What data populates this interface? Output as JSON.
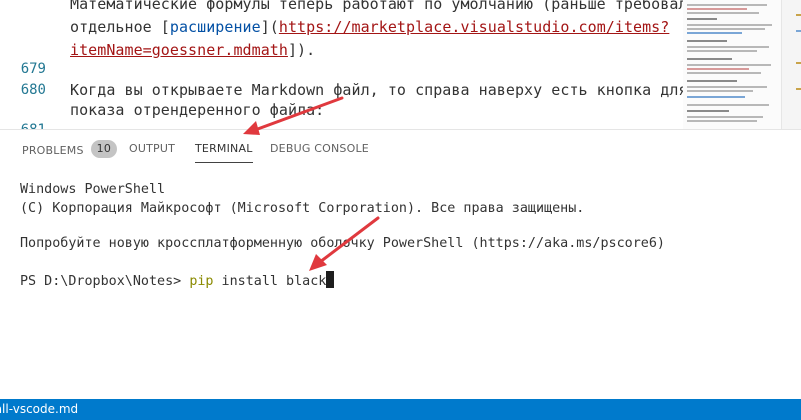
{
  "editor": {
    "lines": [
      {
        "number": "",
        "parts": [
          {
            "text": "Математические формулы теперь работают по умолчанию (раньше требовалось",
            "style": "plain"
          }
        ]
      },
      {
        "number": "",
        "parts": [
          {
            "text": "отдельное [",
            "style": "plain"
          },
          {
            "text": "расширение",
            "style": "blue"
          },
          {
            "text": "](",
            "style": "plain"
          },
          {
            "text": "https://marketplace.visualstudio.com/items?",
            "style": "link"
          }
        ]
      },
      {
        "number": "",
        "parts": [
          {
            "text": "itemName=goessner.mdmath",
            "style": "link"
          },
          {
            "text": "]).",
            "style": "plain"
          }
        ]
      },
      {
        "number": "679",
        "parts": []
      },
      {
        "number": "680",
        "parts": [
          {
            "text": "Когда вы открываете Markdown файл, то справа наверху есть кнопка для",
            "style": "plain"
          }
        ]
      },
      {
        "number": "",
        "parts": [
          {
            "text": "показа отрендеренного файла:",
            "style": "plain"
          }
        ]
      },
      {
        "number": "681",
        "parts": []
      }
    ]
  },
  "panel": {
    "tabs": [
      {
        "label": "PROBLEMS",
        "badge": "10",
        "active": false
      },
      {
        "label": "OUTPUT",
        "badge": "",
        "active": false
      },
      {
        "label": "TERMINAL",
        "badge": "",
        "active": true
      },
      {
        "label": "DEBUG CONSOLE",
        "badge": "",
        "active": false
      }
    ]
  },
  "terminal": {
    "line1": "Windows PowerShell",
    "line2": "(C) Корпорация Майкрософт (Microsoft Corporation). Все права защищены.",
    "line3": "Попробуйте новую кроссплатформенную оболочку PowerShell (https://aka.ms/pscore6)",
    "prompt": "PS D:\\Dropbox\\Notes> ",
    "command": "pip",
    "args": " install black"
  },
  "statusbar": {
    "file": "tall-vscode.md"
  },
  "colors": {
    "accent": "#007acc",
    "link": "#a31515",
    "markup_blue": "#0451a5",
    "command": "#8a8a00",
    "annotation_arrow": "#e0393e"
  }
}
